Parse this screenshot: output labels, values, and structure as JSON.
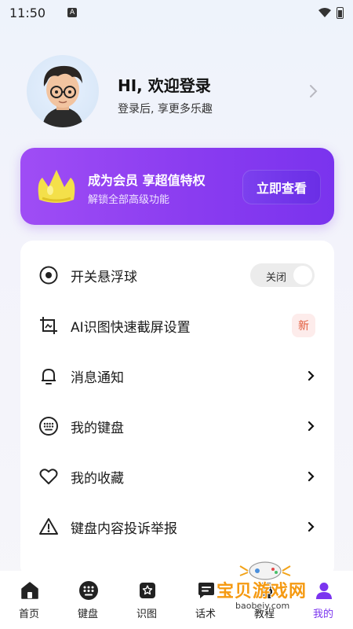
{
  "status_bar": {
    "time": "11:50",
    "notification_badge": "A"
  },
  "profile": {
    "greeting": "HI, 欢迎登录",
    "subtitle": "登录后, 享更多乐趣"
  },
  "vip_banner": {
    "title": "成为会员 享超值特权",
    "subtitle": "解锁全部高级功能",
    "button_label": "立即查看",
    "accent_color": "#8a3cf0"
  },
  "menu": {
    "items": [
      {
        "label": "开关悬浮球",
        "icon": "target-icon",
        "control": "toggle",
        "toggle_label": "关闭",
        "toggle_on": false
      },
      {
        "label": "AI识图快速截屏设置",
        "icon": "crop-icon",
        "control": "badge",
        "badge_label": "新"
      },
      {
        "label": "消息通知",
        "icon": "bell-icon",
        "control": "chevron"
      },
      {
        "label": "我的键盘",
        "icon": "keyboard-icon",
        "control": "chevron"
      },
      {
        "label": "我的收藏",
        "icon": "heart-icon",
        "control": "chevron"
      },
      {
        "label": "键盘内容投诉举报",
        "icon": "warning-icon",
        "control": "chevron"
      }
    ]
  },
  "tab_bar": {
    "tabs": [
      {
        "label": "首页",
        "icon": "home-icon"
      },
      {
        "label": "键盘",
        "icon": "keyboard-icon"
      },
      {
        "label": "识图",
        "icon": "image-search-icon"
      },
      {
        "label": "话术",
        "icon": "chat-icon"
      },
      {
        "label": "教程",
        "icon": "tutorial-icon"
      },
      {
        "label": "我的",
        "icon": "profile-icon",
        "active": true
      }
    ],
    "active_color": "#7b34ef"
  },
  "watermark": {
    "text": "宝贝游戏网",
    "url": "baobeiy.com"
  }
}
